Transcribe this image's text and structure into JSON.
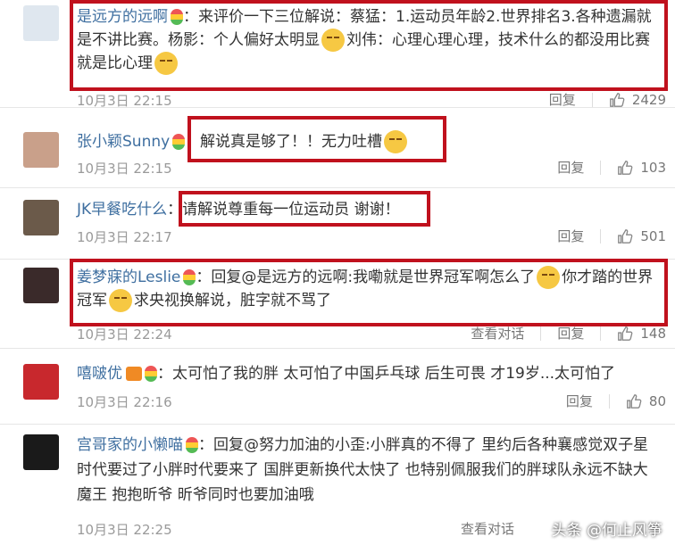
{
  "comments": [
    {
      "user": "是远方的远啊",
      "text_a": "：来评价一下三位解说：蔡猛：1.运动员年龄2.世界排名3.各种遗漏就是不讲比赛。杨影：个人偏好太明显",
      "text_b": "刘伟：心理心理心理，技术什么的都没用比赛就是比心理",
      "time": "10月3日 22:15",
      "reply": "回复",
      "likes": "2429"
    },
    {
      "user": "张小颖Sunny",
      "text": "解说真是够了！！无力吐槽",
      "time": "10月3日 22:15",
      "reply": "回复",
      "likes": "103"
    },
    {
      "user": "JK早餐吃什么",
      "text": "：请解说尊重每一位运动员 谢谢！",
      "time": "10月3日 22:17",
      "reply": "回复",
      "likes": "501"
    },
    {
      "user": "姜梦寐的Leslie",
      "text_a": "：回复@是远方的远啊:我嘞就是世界冠军啊怎么了",
      "text_b": "你才踏的世界冠军",
      "text_c": "求央视换解说，脏字就不骂了",
      "time": "10月3日 22:24",
      "view": "查看对话",
      "reply": "回复",
      "likes": "148"
    },
    {
      "user": "嘻啵优",
      "text": "：太可怕了我的胖 太可怕了中国乒乓球 后生可畏 才19岁...太可怕了",
      "time": "10月3日 22:16",
      "reply": "回复",
      "likes": "80"
    },
    {
      "user": "宫哥家的小懒喵",
      "text": "：回复@努力加油的小歪:小胖真的不得了 里约后各种襄感觉双子星时代要过了小胖时代要来了 国胖更新换代太快了 也特别佩服我们的胖球队永远不缺大魔王 抱抱昕爷 昕爷同时也要加油哦",
      "time": "10月3日 22:25",
      "view": "查看对话",
      "reply": "回复",
      "likes": ""
    }
  ],
  "watermark": "头条 @何止风筝",
  "colors": {
    "highlight": "#c0111d",
    "link": "#3f6fa0",
    "meta": "#9a9a9a"
  },
  "icons": [
    "thumbs-up-icon",
    "smile-emoji-icon",
    "rainbow-badge-icon"
  ]
}
